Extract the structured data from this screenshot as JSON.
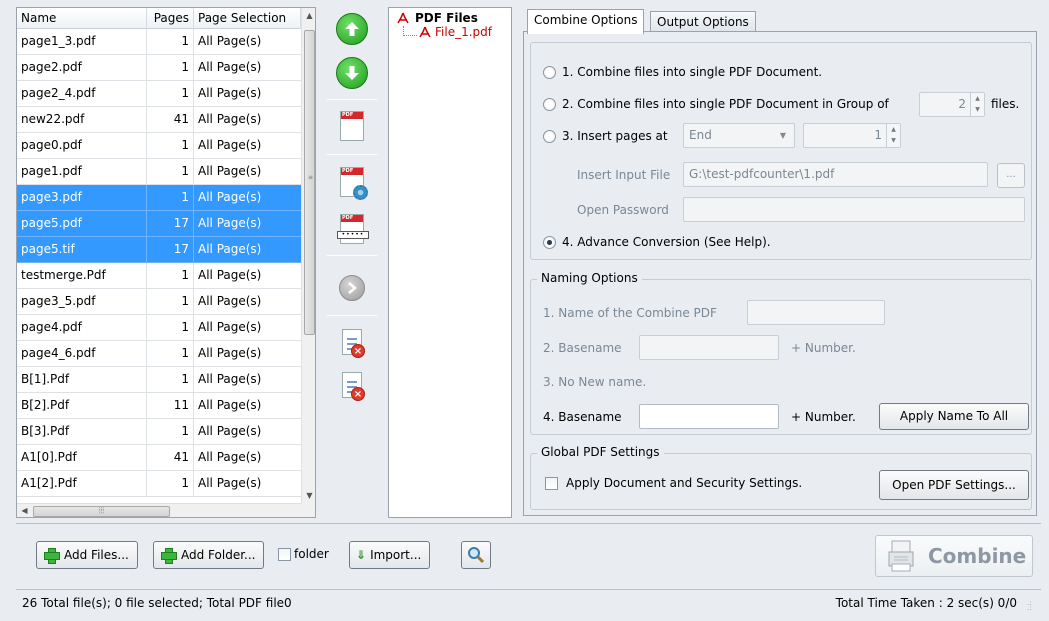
{
  "file_list": {
    "columns": {
      "name": "Name",
      "pages": "Pages",
      "selection": "Page Selection"
    },
    "rows": [
      {
        "name": "page1_3.pdf",
        "pages": "1",
        "selection": "All Page(s)",
        "selected": false
      },
      {
        "name": "page2.pdf",
        "pages": "1",
        "selection": "All Page(s)",
        "selected": false
      },
      {
        "name": "page2_4.pdf",
        "pages": "1",
        "selection": "All Page(s)",
        "selected": false
      },
      {
        "name": "new22.pdf",
        "pages": "41",
        "selection": "All Page(s)",
        "selected": false
      },
      {
        "name": "page0.pdf",
        "pages": "1",
        "selection": "All Page(s)",
        "selected": false
      },
      {
        "name": "page1.pdf",
        "pages": "1",
        "selection": "All Page(s)",
        "selected": false
      },
      {
        "name": "page3.pdf",
        "pages": "1",
        "selection": "All Page(s)",
        "selected": true
      },
      {
        "name": "page5.pdf",
        "pages": "17",
        "selection": "All Page(s)",
        "selected": true
      },
      {
        "name": "page5.tif",
        "pages": "17",
        "selection": "All Page(s)",
        "selected": true
      },
      {
        "name": "testmerge.Pdf",
        "pages": "1",
        "selection": "All Page(s)",
        "selected": false
      },
      {
        "name": "page3_5.pdf",
        "pages": "1",
        "selection": "All Page(s)",
        "selected": false
      },
      {
        "name": "page4.pdf",
        "pages": "1",
        "selection": "All Page(s)",
        "selected": false
      },
      {
        "name": "page4_6.pdf",
        "pages": "1",
        "selection": "All Page(s)",
        "selected": false
      },
      {
        "name": "B[1].Pdf",
        "pages": "1",
        "selection": "All Page(s)",
        "selected": false
      },
      {
        "name": "B[2].Pdf",
        "pages": "11",
        "selection": "All Page(s)",
        "selected": false
      },
      {
        "name": "B[3].Pdf",
        "pages": "1",
        "selection": "All Page(s)",
        "selected": false
      },
      {
        "name": "A1[0].Pdf",
        "pages": "41",
        "selection": "All Page(s)",
        "selected": false
      },
      {
        "name": "A1[2].Pdf",
        "pages": "1",
        "selection": "All Page(s)",
        "selected": false
      }
    ],
    "colors": {
      "selected_bg": "#3399ff",
      "selected_text": "#ffffff"
    }
  },
  "toolbar": {
    "icons": [
      "move-up-icon",
      "move-down-icon",
      "add-pdf-icon",
      "pdf-settings-icon",
      "page-range-icon",
      "next-icon",
      "remove-file-icon",
      "remove-all-icon"
    ]
  },
  "tree": {
    "root_label": "PDF Files",
    "children": [
      "File_1.pdf"
    ]
  },
  "tabs": [
    {
      "label": "Combine Options",
      "active": true
    },
    {
      "label": "Output Options",
      "active": false
    }
  ],
  "combine_options": {
    "option1": "1. Combine files into single PDF Document.",
    "option2": "2. Combine files into single PDF Document in Group of",
    "group_value": "2",
    "files_suffix": "files.",
    "option3": "3. Insert pages at",
    "insert_position": "End",
    "insert_page_value": "1",
    "insert_input_label": "Insert Input File",
    "insert_input_value": "G:\\test-pdfcounter\\1.pdf",
    "browse_label": "...",
    "password_label": "Open Password",
    "password_value": "",
    "option4": "4. Advance Conversion (See Help).",
    "selected_option": 4
  },
  "naming_options": {
    "title": "Naming Options",
    "name_label": "1. Name of the Combine PDF",
    "name_value": "",
    "basename2_label": "2. Basename",
    "basename2_value": "",
    "number_suffix": "+ Number.",
    "no_new_name": "3. No New name.",
    "basename4_label": "4. Basename",
    "basename4_value": "",
    "apply_button": "Apply Name To All"
  },
  "global_settings": {
    "title": "Global PDF Settings",
    "checkbox_label": "Apply Document and Security Settings.",
    "checked": false,
    "open_button": "Open PDF Settings..."
  },
  "bottom": {
    "add_files": "Add Files...",
    "add_folder": "Add Folder...",
    "folder_checkbox": "folder",
    "import": "Import...",
    "combine": "Combine"
  },
  "status": {
    "left": "26 Total file(s); 0 file selected; Total PDF file0",
    "right": "Total Time Taken : 2 sec(s)  0/0"
  }
}
